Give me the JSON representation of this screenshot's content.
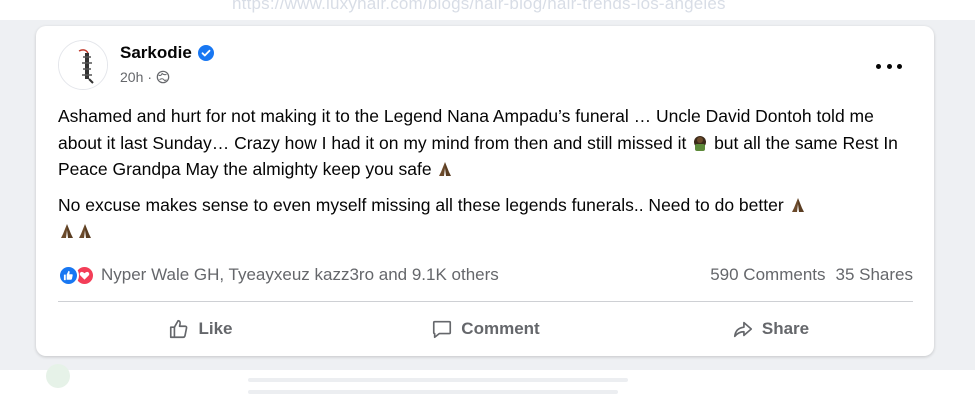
{
  "background": {
    "url_text": "https://www.luxyhair.com/blogs/hair-blog/hair-trends-los-angeles"
  },
  "post": {
    "author": {
      "name": "Sarkodie",
      "verified": true,
      "avatar_icon": "sarkodie-logo-avatar"
    },
    "time": "20h",
    "privacy_icon": "globe-icon",
    "more_icon": "more-horizontal-icon",
    "paragraphs": [
      {
        "text_a": "Ashamed and hurt for not making it to the Legend Nana Ampadu’s funeral … Uncle David Dontoh told me about it last Sunday… Crazy how I had it on my mind from then and still missed it ",
        "text_b": " but all the same Rest In Peace Grandpa May the almighty keep you safe "
      },
      {
        "text_a": "No excuse makes sense to even myself missing all these legends funerals.. Need to do better "
      }
    ],
    "emojis": {
      "face": "face-palm-emoji",
      "pray": "folded-hands-emoji"
    },
    "reactions": {
      "icons": [
        "like-reaction-icon",
        "love-reaction-icon"
      ],
      "summary": "Nyper Wale GH, Tyeayxeuz kazz3ro and 9.1K others"
    },
    "comments": "590 Comments",
    "shares": "35 Shares",
    "actions": {
      "like": "Like",
      "comment": "Comment",
      "share": "Share"
    }
  },
  "colors": {
    "brand_blue": "#1877f2",
    "love_red": "#f33e58",
    "secondary_text": "#65676b",
    "primary_text": "#050505"
  }
}
